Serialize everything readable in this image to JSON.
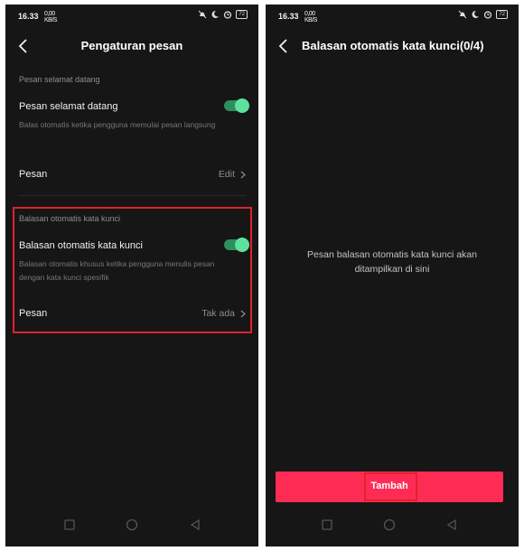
{
  "status": {
    "time": "16.33",
    "net_top": "0,00",
    "net_bottom": "KB/S",
    "battery": "72"
  },
  "left": {
    "title": "Pengaturan pesan",
    "welcome": {
      "section": "Pesan selamat datang",
      "toggle_title": "Pesan selamat datang",
      "toggle_on": true,
      "desc": "Balas otomatis ketika pengguna memulai pesan langsung",
      "message_label": "Pesan",
      "message_value": "Edit"
    },
    "keyword": {
      "section": "Balasan otomatis kata kunci",
      "toggle_title": "Balasan otomatis kata kunci",
      "toggle_on": true,
      "desc": "Balasan otomatis khusus ketika pengguna menulis pesan dengan kata kunci spesifik",
      "message_label": "Pesan",
      "message_value": "Tak ada"
    }
  },
  "right": {
    "title": "Balasan otomatis kata kunci(0/4)",
    "empty_text": "Pesan balasan otomatis kata kunci akan\nditampilkan di sini",
    "add_button": "Tambah"
  },
  "colors": {
    "accent_green": "#5de29e",
    "primary_red": "#fe2c55",
    "highlight_border": "#e1222a",
    "background": "#161616"
  },
  "icons": [
    "back-icon",
    "chevron-right-icon",
    "mute-icon",
    "moon-icon",
    "alarm-icon",
    "square-nav-icon",
    "circle-nav-icon",
    "triangle-back-nav-icon"
  ]
}
